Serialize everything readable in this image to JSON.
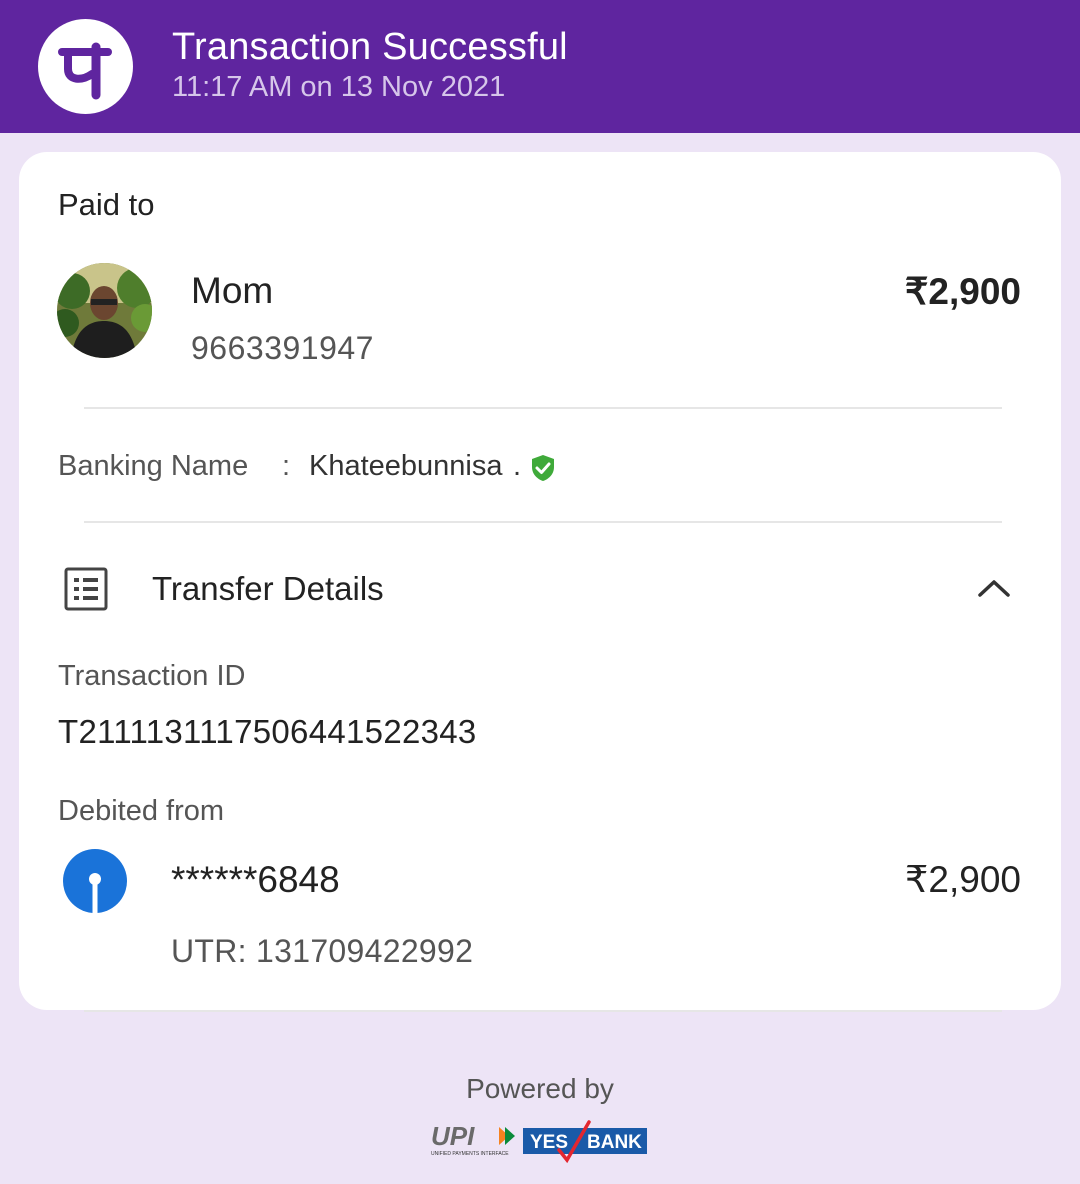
{
  "header": {
    "title": "Transaction Successful",
    "timestamp": "11:17 AM on 13 Nov 2021",
    "brand_color": "#5f259f"
  },
  "paid_to": {
    "label": "Paid to",
    "name": "Mom",
    "phone": "9663391947",
    "amount": "₹2,900"
  },
  "banking": {
    "label": "Banking Name",
    "separator": ":",
    "name": "Khateebunnisa",
    "trailing": ".",
    "verified_icon": "shield-check-icon"
  },
  "transfer_details": {
    "title": "Transfer Details",
    "icon": "receipt-list-icon",
    "toggle_icon": "chevron-up-icon",
    "transaction_id_label": "Transaction ID",
    "transaction_id": "T2111131117506441522343",
    "debited_label": "Debited from",
    "account": "******6848",
    "debited_amount": "₹2,900",
    "utr": "UTR: 131709422992"
  },
  "footer": {
    "powered_by": "Powered by",
    "upi_text": "UPI",
    "upi_subtext": "UNIFIED PAYMENTS INTERFACE",
    "bank_text_1": "YES",
    "bank_text_2": "BANK"
  }
}
